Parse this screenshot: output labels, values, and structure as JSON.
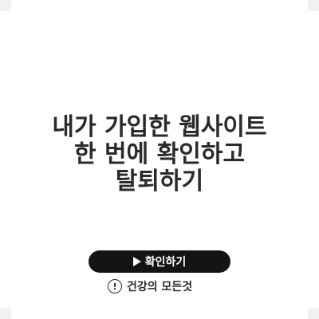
{
  "article": {
    "title_lines": [
      "내가 가입한 웹사이트",
      "한 번에 확인하고",
      "탈퇴하기"
    ]
  },
  "actions": {
    "confirm_label": "확인하기"
  },
  "brand": {
    "name": "건강의 모든것",
    "icon_glyph": "!",
    "icon": "alert-circle-icon"
  },
  "colors": {
    "button_bg": "#141414",
    "title_text": "#2a2a2a",
    "page_bg": "#ffffff"
  }
}
